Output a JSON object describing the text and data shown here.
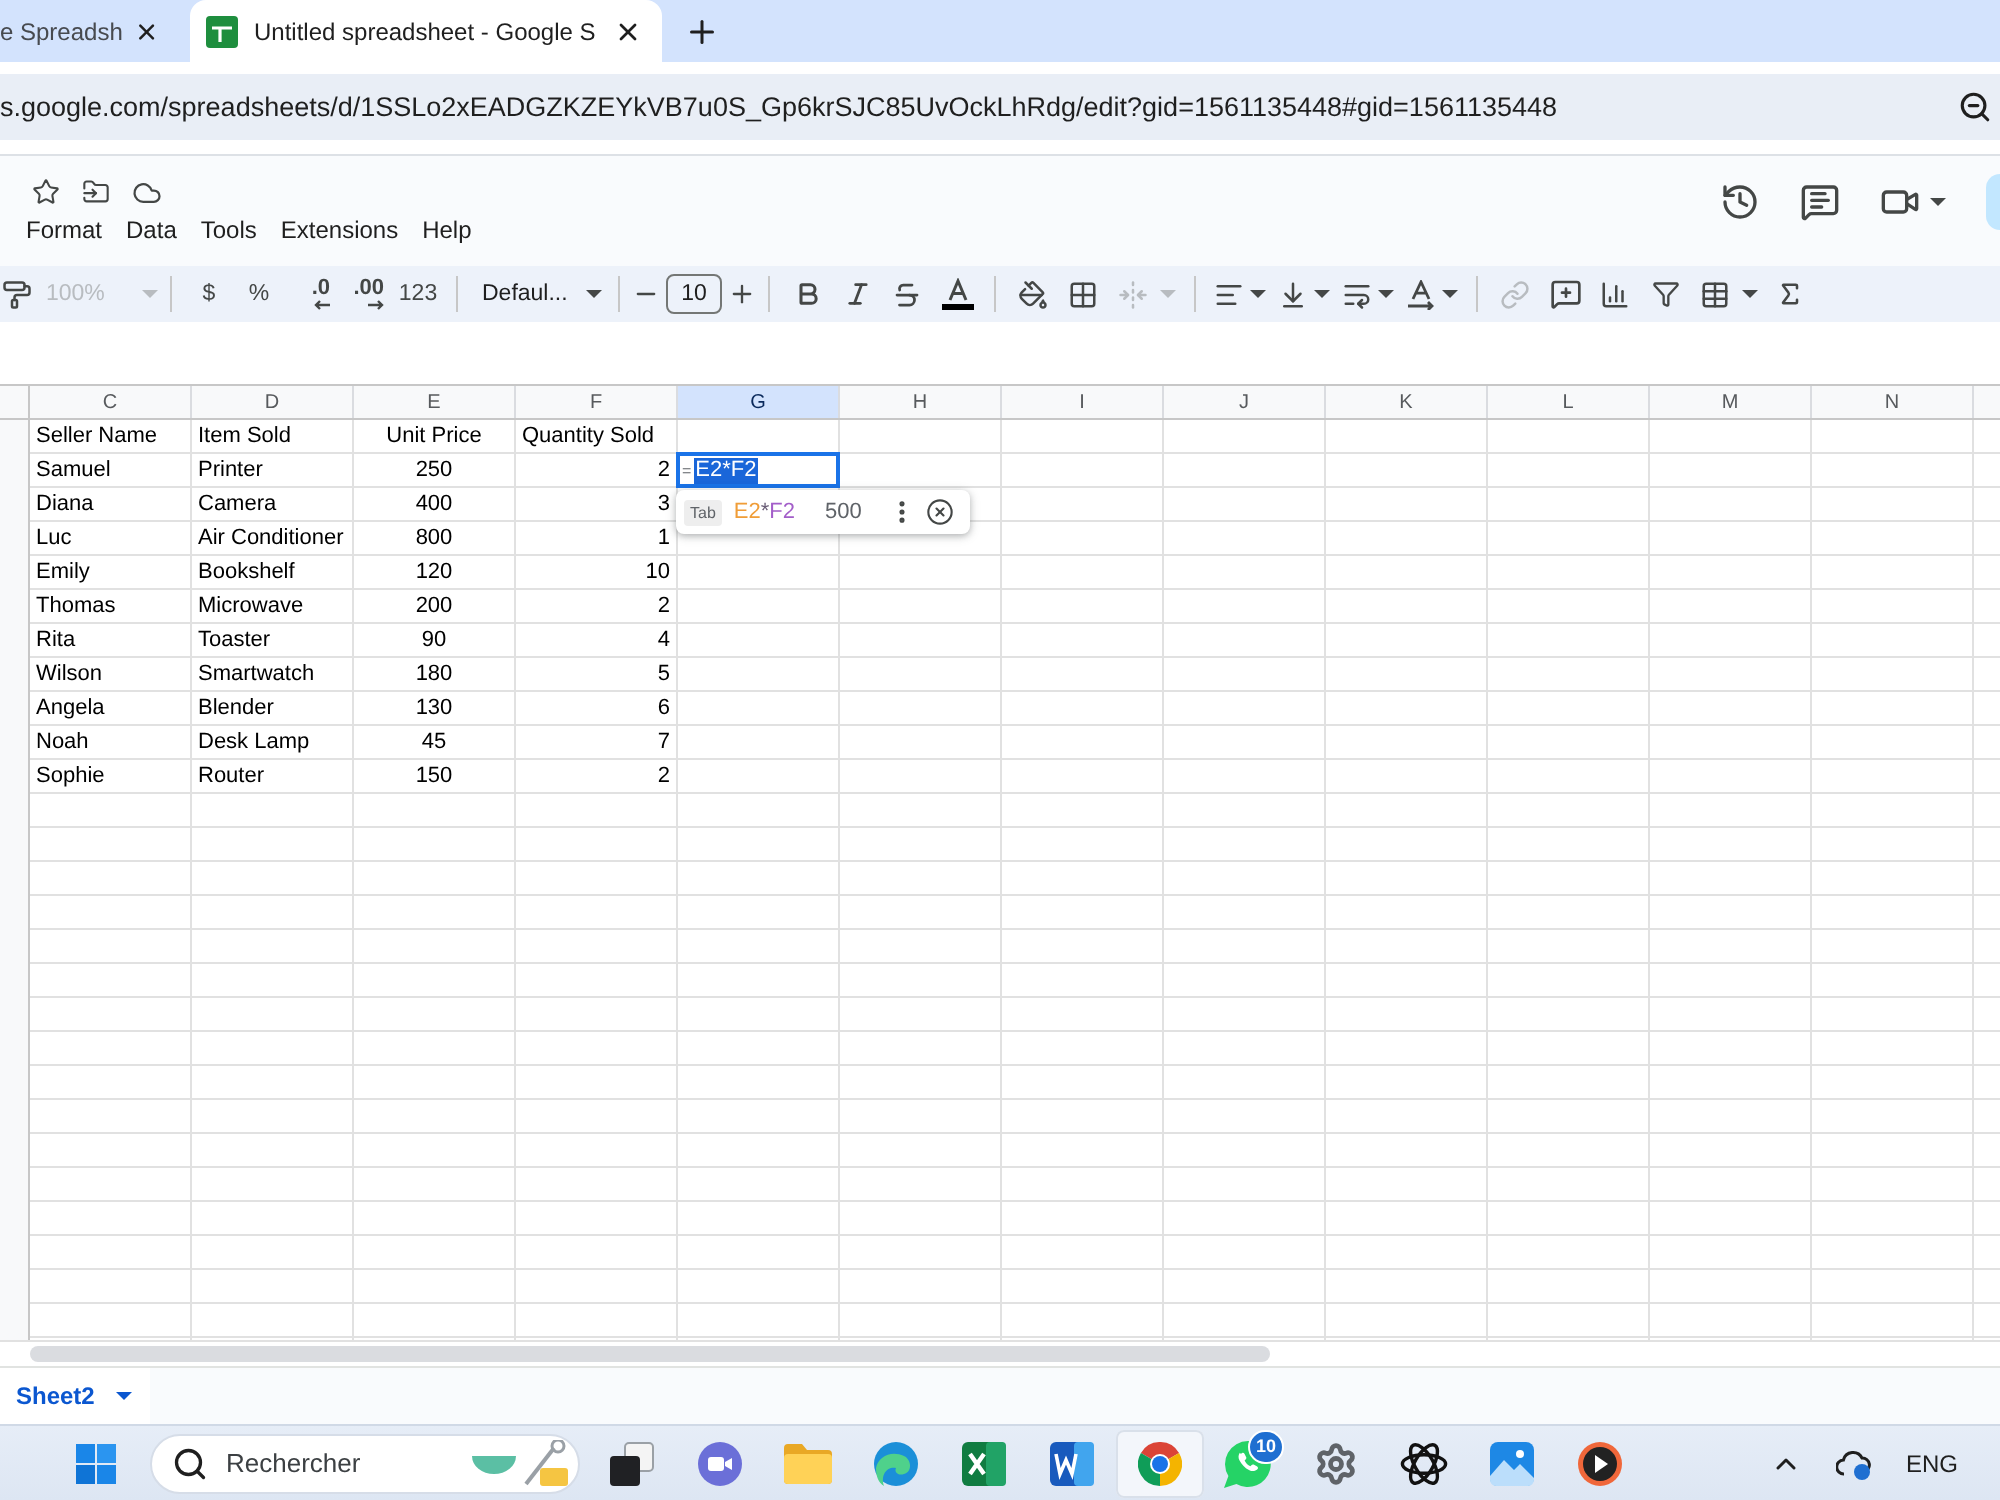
{
  "browser": {
    "tabs": [
      {
        "title": "e Spreadsh",
        "selected": false
      },
      {
        "title": "Untitled spreadsheet - Google S",
        "selected": true
      }
    ],
    "address": "s.google.com/spreadsheets/d/1SSLo2xEADGZKZEYkVB7u0S_Gp6krSJC85UvOckLhRdg/edit?gid=1561135448#gid=1561135448"
  },
  "menu": [
    "Format",
    "Data",
    "Tools",
    "Extensions",
    "Help"
  ],
  "toolbar": {
    "zoom": {
      "label": "100%",
      "disabled": true
    },
    "currency": "$",
    "percent": "%",
    "decrease_decimals": ".0",
    "increase_decimals": ".00",
    "number_format": "123",
    "font": "Defaul...",
    "font_size": "10",
    "merge": {
      "disabled": true
    },
    "link": {
      "disabled": true
    }
  },
  "grid": {
    "columns": [
      {
        "label": "C",
        "selected": false
      },
      {
        "label": "D",
        "selected": false
      },
      {
        "label": "E",
        "selected": false
      },
      {
        "label": "F",
        "selected": false
      },
      {
        "label": "G",
        "selected": true
      },
      {
        "label": "H",
        "selected": false
      },
      {
        "label": "I",
        "selected": false
      },
      {
        "label": "J",
        "selected": false
      },
      {
        "label": "K",
        "selected": false
      },
      {
        "label": "L",
        "selected": false
      },
      {
        "label": "M",
        "selected": false
      },
      {
        "label": "N",
        "selected": false
      }
    ],
    "rows": [
      [
        "Seller Name",
        "Item Sold",
        "Unit Price",
        "Quantity Sold"
      ],
      [
        "Samuel",
        "Printer",
        "250",
        "2"
      ],
      [
        "Diana",
        "Camera",
        "400",
        "3"
      ],
      [
        "Luc",
        "Air Conditioner",
        "800",
        "1"
      ],
      [
        "Emily",
        "Bookshelf",
        "120",
        "10"
      ],
      [
        "Thomas",
        "Microwave",
        "200",
        "2"
      ],
      [
        "Rita",
        "Toaster",
        "90",
        "4"
      ],
      [
        "Wilson",
        "Smartwatch",
        "180",
        "5"
      ],
      [
        "Angela",
        "Blender",
        "130",
        "6"
      ],
      [
        "Noah",
        "Desk Lamp",
        "45",
        "7"
      ],
      [
        "Sophie",
        "Router",
        "150",
        "2"
      ]
    ],
    "editor": {
      "text": "=",
      "selected_text": "E2*F2"
    },
    "suggestion": {
      "key_hint": "Tab",
      "formula": [
        {
          "text": "E2",
          "color": "#f09d38"
        },
        {
          "text": "*",
          "color": "#6b5f78"
        },
        {
          "text": "F2",
          "color": "#a35ec9"
        }
      ],
      "result": "500"
    }
  },
  "sheet_tabs": [
    {
      "label": "Sheet2",
      "selected": true
    }
  ],
  "taskbar": {
    "search": {
      "placeholder": "Rechercher"
    },
    "apps": [
      {
        "kind": "task-view",
        "selected": false
      },
      {
        "kind": "video-chat",
        "selected": false
      },
      {
        "kind": "folder",
        "selected": false
      },
      {
        "kind": "wave-browser",
        "selected": false
      },
      {
        "kind": "sheet-app",
        "selected": false
      },
      {
        "kind": "doc-app",
        "selected": false
      },
      {
        "kind": "round-browser",
        "selected": true
      },
      {
        "kind": "chat",
        "selected": false,
        "badge": "10"
      },
      {
        "kind": "gear",
        "selected": false
      },
      {
        "kind": "knot",
        "selected": false
      },
      {
        "kind": "photos",
        "selected": false
      },
      {
        "kind": "player",
        "selected": false
      }
    ],
    "language": "ENG"
  }
}
